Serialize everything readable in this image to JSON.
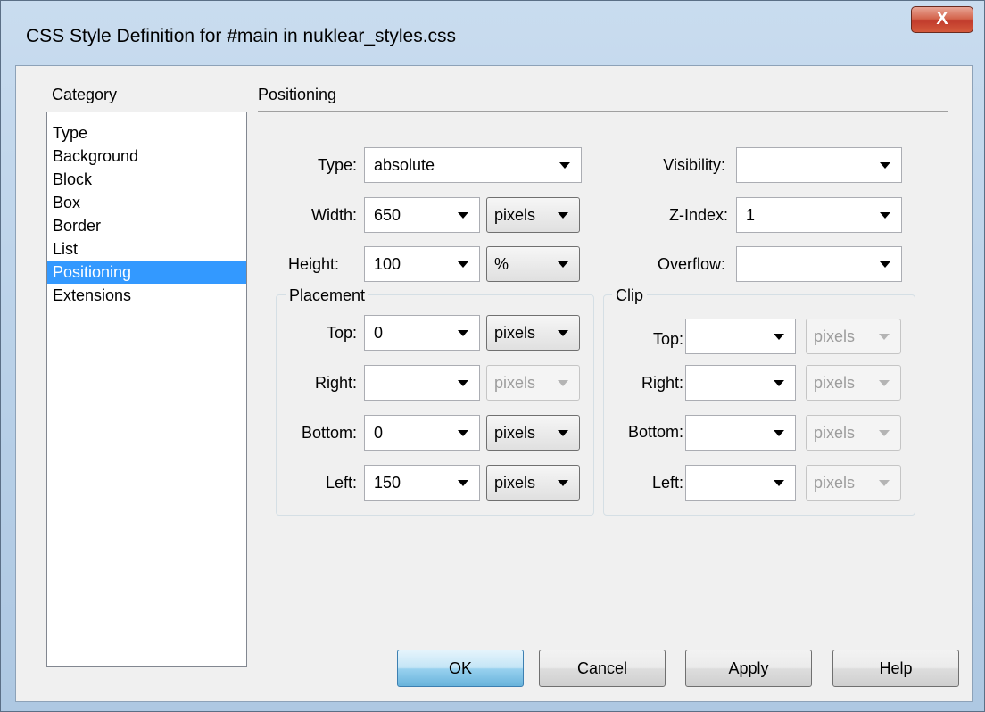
{
  "window": {
    "title": "CSS Style Definition for #main in nuklear_styles.css",
    "close_label": "X"
  },
  "category": {
    "heading": "Category",
    "items": [
      "Type",
      "Background",
      "Block",
      "Box",
      "Border",
      "List",
      "Positioning",
      "Extensions"
    ],
    "selected": "Positioning"
  },
  "section_title": "Positioning",
  "fields": {
    "type": {
      "label": "Type:",
      "value": "absolute"
    },
    "width": {
      "label": "Width:",
      "value": "650",
      "unit": "pixels"
    },
    "height": {
      "label": "Height:",
      "value": "100",
      "unit": "%"
    },
    "visibility": {
      "label": "Visibility:",
      "value": ""
    },
    "z_index": {
      "label": "Z-Index:",
      "value": "1"
    },
    "overflow": {
      "label": "Overflow:",
      "value": ""
    }
  },
  "placement": {
    "label": "Placement",
    "top": {
      "label": "Top:",
      "value": "0",
      "unit": "pixels"
    },
    "right": {
      "label": "Right:",
      "value": "",
      "unit": "pixels"
    },
    "bottom": {
      "label": "Bottom:",
      "value": "0",
      "unit": "pixels"
    },
    "left": {
      "label": "Left:",
      "value": "150",
      "unit": "pixels"
    }
  },
  "clip": {
    "label": "Clip",
    "top": {
      "label": "Top:",
      "value": "",
      "unit": "pixels"
    },
    "right": {
      "label": "Right:",
      "value": "",
      "unit": "pixels"
    },
    "bottom": {
      "label": "Bottom:",
      "value": "",
      "unit": "pixels"
    },
    "left": {
      "label": "Left:",
      "value": "",
      "unit": "pixels"
    }
  },
  "buttons": {
    "ok": "OK",
    "cancel": "Cancel",
    "apply": "Apply",
    "help": "Help"
  }
}
